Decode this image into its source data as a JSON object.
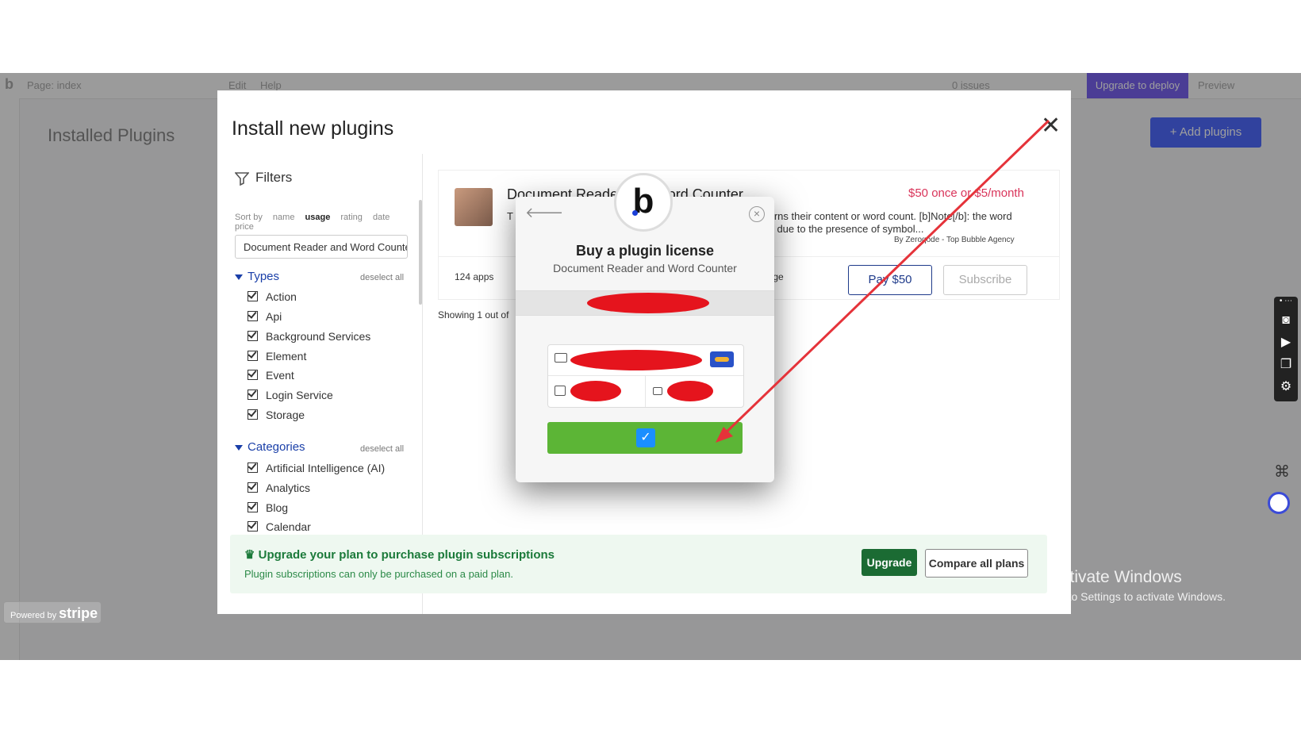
{
  "app": {
    "logo": "b",
    "page_label": "Page: index",
    "menu_edit": "Edit",
    "menu_help": "Help",
    "issues": "0 issues",
    "upgrade_deploy": "Upgrade to deploy",
    "preview": "Preview",
    "bg_title": "Installed Plugins",
    "bg_add": "+ Add plugins"
  },
  "panel": {
    "title": "Install new plugins",
    "filters_label": "Filters",
    "sort_by_label": "Sort by",
    "sort_options": [
      "name",
      "usage",
      "rating",
      "date",
      "price"
    ],
    "sort_active": "usage",
    "search_value": "Document Reader and Word Counter",
    "types_heading": "Types",
    "deselect_all": "deselect all",
    "types": [
      "Action",
      "Api",
      "Background Services",
      "Element",
      "Event",
      "Login Service",
      "Storage"
    ],
    "categories_heading": "Categories",
    "categories": [
      "Artificial Intelligence (AI)",
      "Analytics",
      "Blog",
      "Calendar"
    ]
  },
  "plugin": {
    "name": "Document Reader and Word Counter",
    "price": "$50 once or $5/month",
    "desc_left": "T",
    "desc_right": "turns their content or word count. [b]Note[/b]: the word",
    "desc_right2": "rs due to the presence of symbol...",
    "by": "By Zeroqode - Top Bubble Agency",
    "apps": "124 apps",
    "page_link": "page",
    "pay_label": "Pay $50",
    "subscribe_label": "Subscribe",
    "showing": "Showing 1 out of"
  },
  "upgrade": {
    "title": "Upgrade your plan to purchase plugin subscriptions",
    "subtitle": "Plugin subscriptions can only be purchased on a paid plan.",
    "upgrade_btn": "Upgrade",
    "compare_btn": "Compare all plans"
  },
  "modal": {
    "logo": "b",
    "title": "Buy a plugin license",
    "subtitle": "Document Reader and Word Counter"
  },
  "watermark": {
    "line1": "Activate Windows",
    "line2": "Go to Settings to activate Windows."
  },
  "stripe_badge": {
    "powered": "Powered by",
    "brand": "stripe"
  },
  "colors": {
    "accent": "#1a3fa8",
    "price": "#d9345a",
    "pay_button": "#5cb536",
    "annotation_arrow": "#e5333a"
  }
}
